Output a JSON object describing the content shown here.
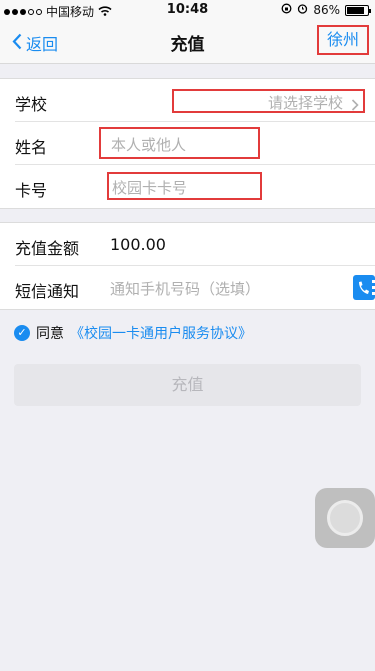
{
  "status": {
    "carrier": "中国移动",
    "time": "10:48",
    "battery": "86%",
    "battery_level": 0.86
  },
  "nav": {
    "back": "返回",
    "title": "充值",
    "city": "徐州"
  },
  "form": {
    "school_label": "学校",
    "school_placeholder": "请选择学校",
    "name_label": "姓名",
    "name_placeholder": "本人或他人",
    "card_label": "卡号",
    "card_placeholder": "校园卡卡号"
  },
  "payment": {
    "amount_label": "充值金额",
    "amount_value": "100.00",
    "sms_label": "短信通知",
    "sms_placeholder": "通知手机号码（选填）"
  },
  "agreement": {
    "prefix": "同意",
    "link": "《校园一卡通用户服务协议》"
  },
  "submit_label": "充值",
  "colors": {
    "accent": "#1a8cf0",
    "highlight": "#e23b3b"
  }
}
